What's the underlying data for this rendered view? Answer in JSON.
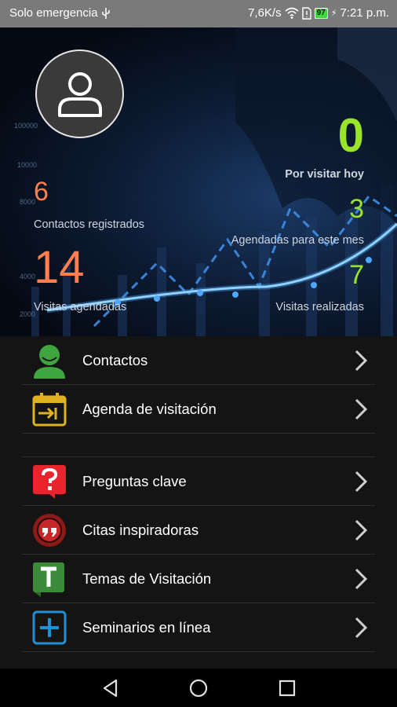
{
  "status_bar": {
    "carrier": "Solo emergencia",
    "usb_icon": "usb-icon",
    "speed": "7,6K/s",
    "wifi_icon": "wifi-icon",
    "sim_icon": "sim-icon",
    "battery_level": "97",
    "time": "7:21 p.m."
  },
  "hero": {
    "avatar_icon": "user-icon",
    "background_axis_ticks": [
      "100000",
      "10000",
      "8000",
      "4000",
      "2000"
    ],
    "contacts_count": "6",
    "contacts_label": "Contactos registrados",
    "visits_scheduled_count": "14",
    "visits_scheduled_label": "Visitas agendadas",
    "to_visit_today_count": "0",
    "to_visit_today_label": "Por visitar hoy",
    "scheduled_month_count": "3",
    "scheduled_month_label": "Agendadas para este mes",
    "visits_done_count": "7",
    "visits_done_label": "Visitas realizadas"
  },
  "colors": {
    "orange": "#ff7f50",
    "green": "#9be22d"
  },
  "menu": {
    "items": [
      {
        "label": "Contactos",
        "icon": "contact-person-icon"
      },
      {
        "label": "Agenda de visitación",
        "icon": "calendar-icon"
      },
      {
        "label": "Preguntas clave",
        "icon": "question-icon"
      },
      {
        "label": "Citas inspiradoras",
        "icon": "quote-icon"
      },
      {
        "label": "Temas de Visitación",
        "icon": "topic-icon"
      },
      {
        "label": "Seminarios en línea",
        "icon": "plus-icon"
      }
    ]
  },
  "nav_bar": {
    "back_icon": "back-icon",
    "home_icon": "home-icon",
    "recents_icon": "recents-icon"
  }
}
